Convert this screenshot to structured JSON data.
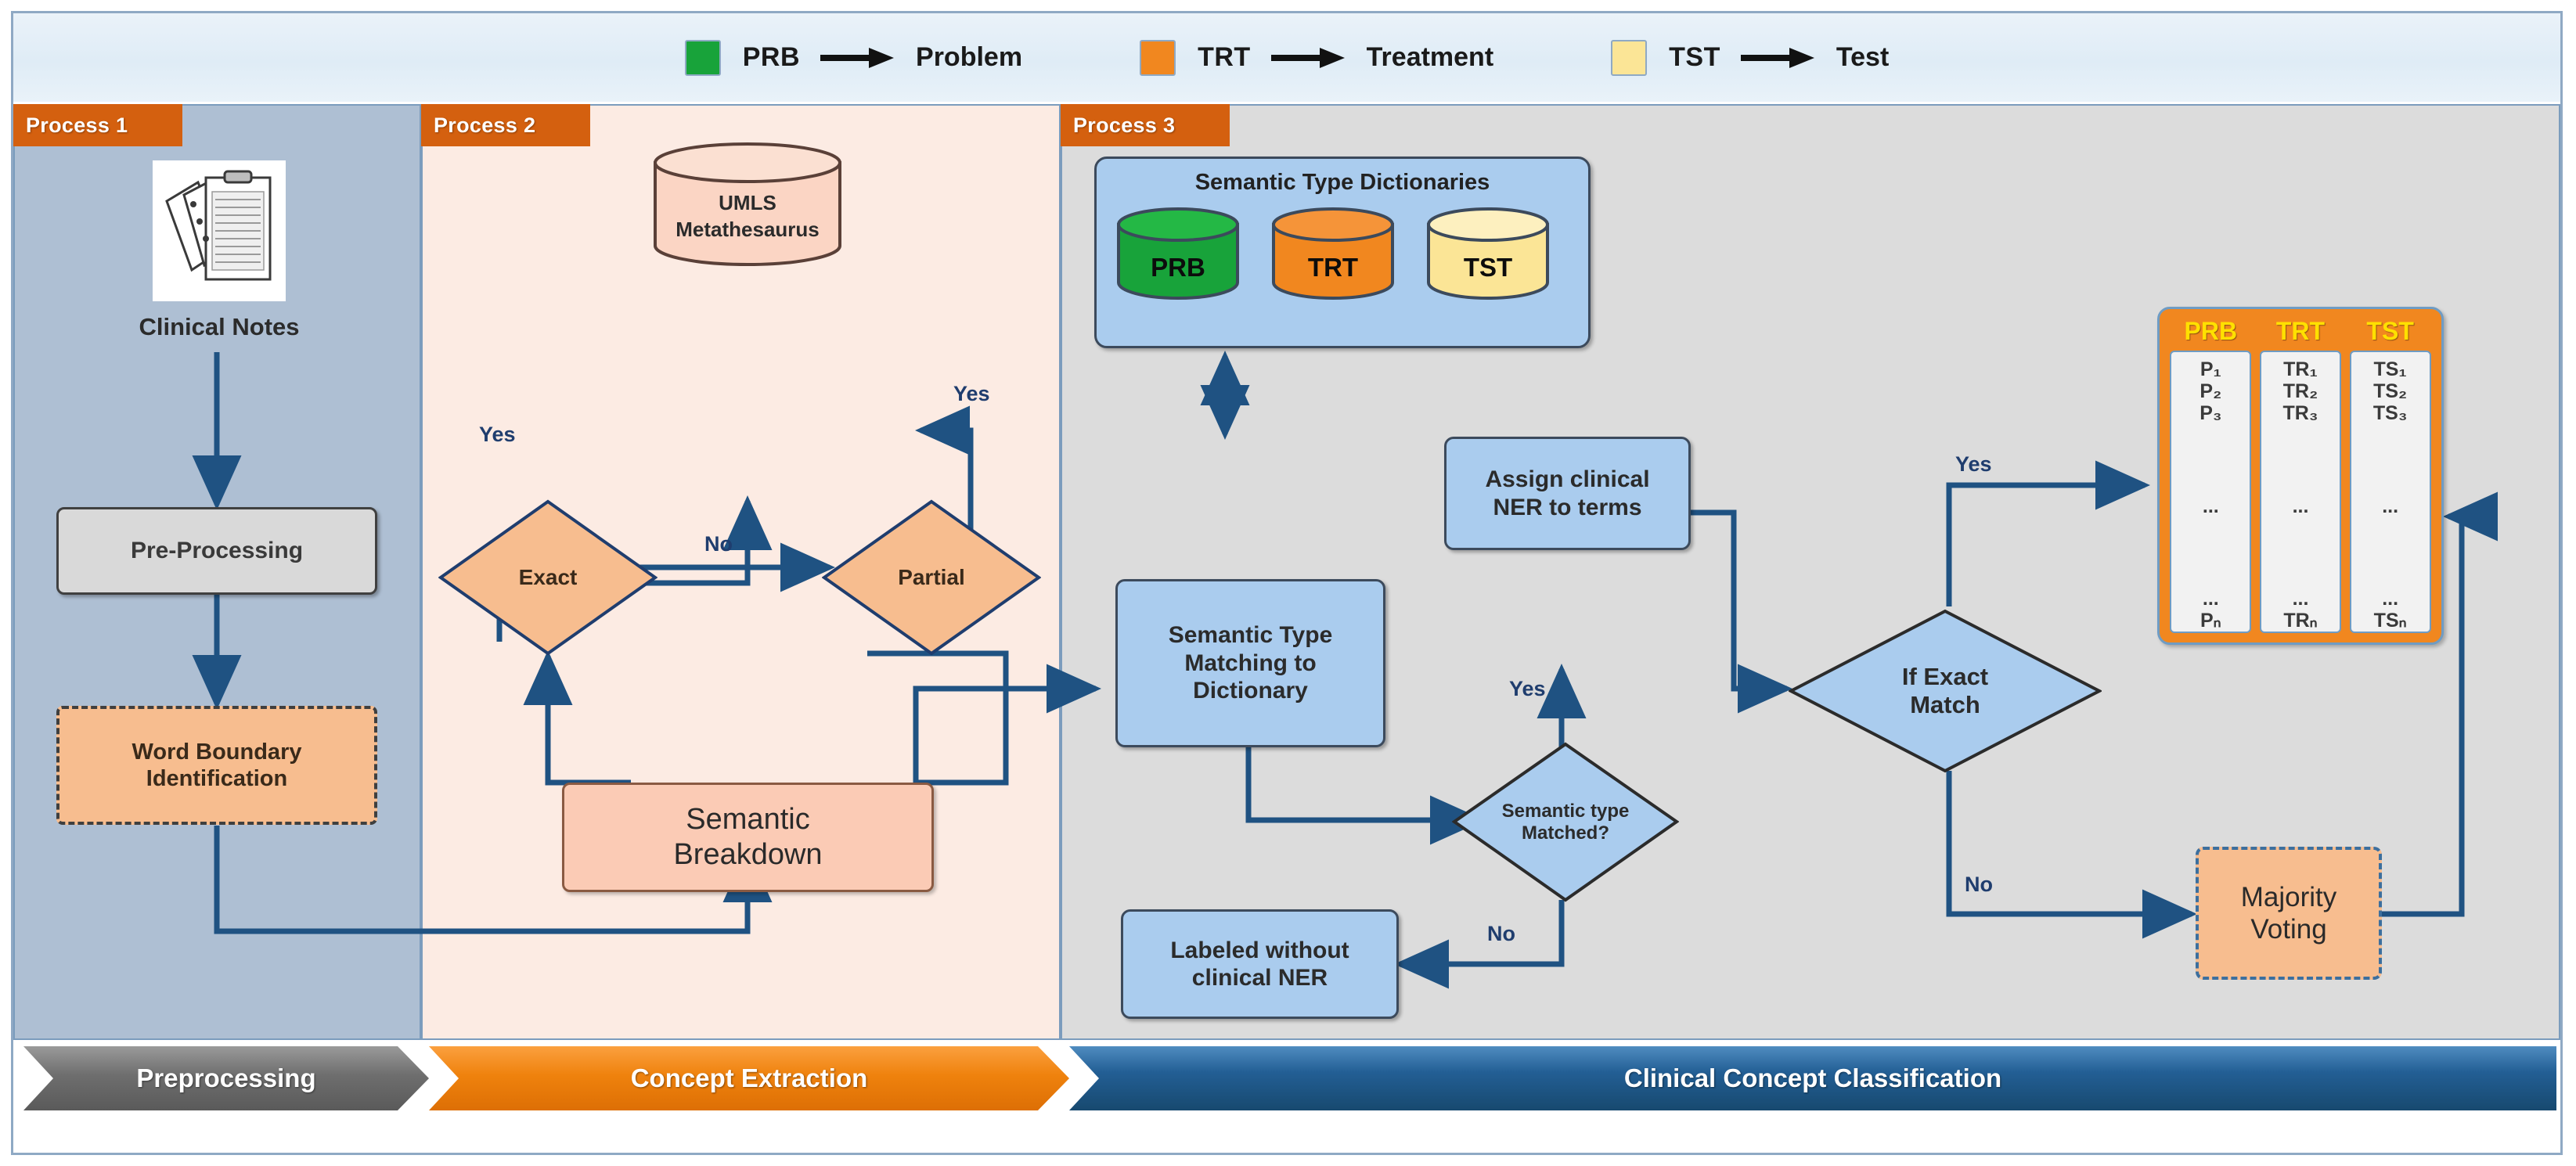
{
  "legend": {
    "items": [
      {
        "code": "PRB",
        "label": "Problem",
        "color": "#18a33a",
        "swatch_name": "prb-swatch"
      },
      {
        "code": "TRT",
        "label": "Treatment",
        "color": "#f1871f",
        "swatch_name": "trt-swatch"
      },
      {
        "code": "TST",
        "label": "Test",
        "color": "#fbe596",
        "swatch_name": "tst-swatch"
      }
    ]
  },
  "panels": [
    {
      "tag": "Process 1",
      "bg": "#aebfd3"
    },
    {
      "tag": "Process 2",
      "bg": "#fcebe3"
    },
    {
      "tag": "Process 3",
      "bg": "#dcdcdc"
    }
  ],
  "process1": {
    "notes_label": "Clinical Notes",
    "preprocessing": "Pre-Processing",
    "word_boundary_line1": "Word Boundary",
    "word_boundary_line2": "Identification"
  },
  "process2": {
    "umls_line1": "UMLS",
    "umls_line2": "Metathesaurus",
    "exact": "Exact",
    "partial": "Partial",
    "semantic_line1": "Semantic",
    "semantic_line2": "Breakdown",
    "label_yes_left": "Yes",
    "label_no_mid": "No",
    "label_yes_right": "Yes"
  },
  "process3": {
    "dict_title": "Semantic Type Dictionaries",
    "dictionaries": [
      {
        "code": "PRB",
        "color": "#18a33a"
      },
      {
        "code": "TRT",
        "color": "#f1871f"
      },
      {
        "code": "TST",
        "color": "#fbe596"
      }
    ],
    "stm_line1": "Semantic Type",
    "stm_line2": "Matching to",
    "stm_line3": "Dictionary",
    "assign_line1": "Assign clinical",
    "assign_line2": "NER to terms",
    "sem_matched_line1": "Semantic type",
    "sem_matched_line2": "Matched?",
    "labeled_line1": "Labeled without",
    "labeled_line2": "clinical NER",
    "if_exact_line1": "If Exact",
    "if_exact_line2": "Match",
    "majority_line1": "Majority",
    "majority_line2": "Voting",
    "label_yes_assign": "Yes",
    "label_no_labeled": "No",
    "label_yes_table": "Yes",
    "label_no_majority": "No"
  },
  "result_table": {
    "columns": [
      {
        "header": "PRB",
        "cells": [
          "P₁",
          "P₂",
          "P₃",
          "...",
          "...",
          "Pₙ"
        ]
      },
      {
        "header": "TRT",
        "cells": [
          "TR₁",
          "TR₂",
          "TR₃",
          "...",
          "...",
          "TRₙ"
        ]
      },
      {
        "header": "TST",
        "cells": [
          "TS₁",
          "TS₂",
          "TS₃",
          "...",
          "...",
          "TSₙ"
        ]
      }
    ],
    "header_color": "#ffe000",
    "panel_color": "#f1871f"
  },
  "ribbons": [
    {
      "label": "Preprocessing",
      "color": "#6e6e6e"
    },
    {
      "label": "Concept Extraction",
      "color": "#e87c0c"
    },
    {
      "label": "Clinical Concept Classification",
      "color": "#1f5f96"
    }
  ],
  "colors": {
    "edge": "#1f5282",
    "tag": "#d4600f",
    "panel1": "#aebfd3",
    "panel2": "#fcebe3",
    "panel3": "#dcdcdc"
  }
}
